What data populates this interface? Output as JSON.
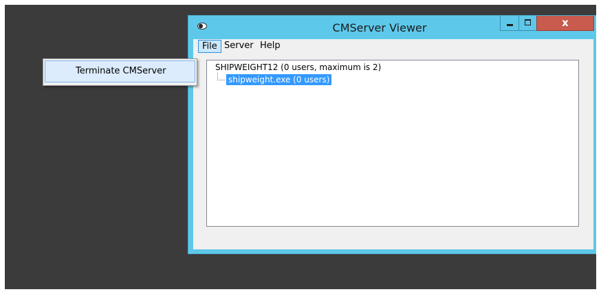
{
  "window": {
    "title": "CMServer Viewer",
    "controls": {
      "minimize_icon": "minimize-icon",
      "maximize_icon": "maximize-icon",
      "close_label": "x"
    }
  },
  "menubar": {
    "items": [
      {
        "label": "File",
        "active": true
      },
      {
        "label": "Server",
        "active": false
      },
      {
        "label": "Help",
        "active": false
      }
    ]
  },
  "file_menu": {
    "items": [
      {
        "label": "Terminate CMServer"
      }
    ]
  },
  "tree": {
    "root": {
      "label": "SHIPWEIGHT12 (0 users, maximum is 2)",
      "children": [
        {
          "label": "shipweight.exe (0 users)",
          "selected": true
        }
      ]
    }
  },
  "colors": {
    "window_frame": "#5ec8ea",
    "close_button": "#c85a4e",
    "selection": "#3399ff",
    "desktop": "#3b3b3b"
  }
}
